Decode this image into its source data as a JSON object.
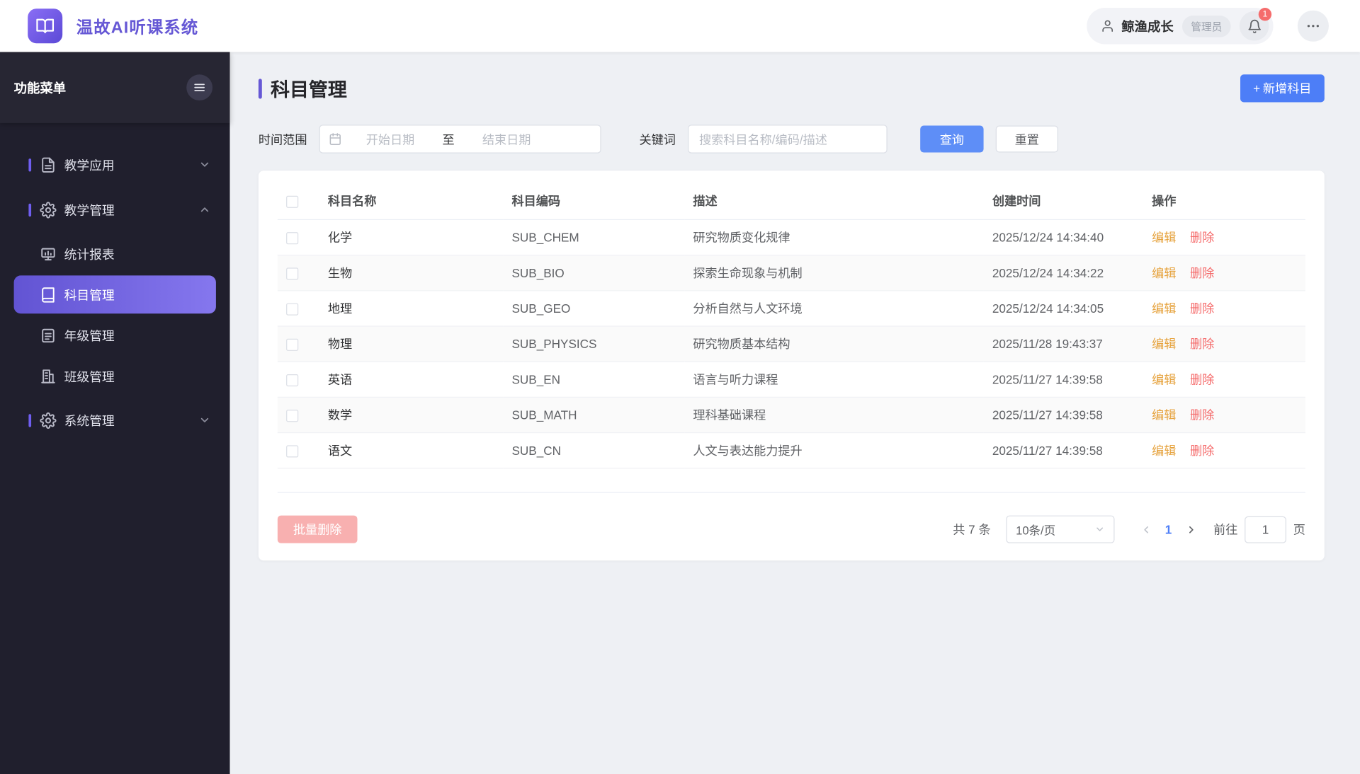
{
  "colors": {
    "brand_purple": "#6658d5",
    "primary_blue": "#4d7ef7",
    "edit_orange": "#e6a23c",
    "danger_red": "#f56c6c",
    "sidebar_bg": "#201f2d"
  },
  "header": {
    "app_title": "温故AI听课系统",
    "user_name": "鲸渔成长",
    "user_role": "管理员",
    "notification_badge": "1"
  },
  "sidebar": {
    "menu_title": "功能菜单",
    "items": {
      "teaching_app": "教学应用",
      "teaching_mgmt": "教学管理",
      "stats_report": "统计报表",
      "subject_mgmt": "科目管理",
      "grade_mgmt": "年级管理",
      "class_mgmt": "班级管理",
      "system_mgmt": "系统管理"
    }
  },
  "page": {
    "title": "科目管理",
    "add_button_icon": "+",
    "add_button": "新增科目"
  },
  "filters": {
    "date_label": "时间范围",
    "start_placeholder": "开始日期",
    "separator": "至",
    "end_placeholder": "结束日期",
    "keyword_label": "关键词",
    "keyword_placeholder": "搜索科目名称/编码/描述",
    "search_button": "查询",
    "reset_button": "重置"
  },
  "table": {
    "columns": [
      "科目名称",
      "科目编码",
      "描述",
      "创建时间",
      "操作"
    ],
    "actions": {
      "edit": "编辑",
      "delete": "删除"
    },
    "rows": [
      {
        "name": "化学",
        "code": "SUB_CHEM",
        "desc": "研究物质变化规律",
        "created": "2025/12/24 14:34:40"
      },
      {
        "name": "生物",
        "code": "SUB_BIO",
        "desc": "探索生命现象与机制",
        "created": "2025/12/24 14:34:22"
      },
      {
        "name": "地理",
        "code": "SUB_GEO",
        "desc": "分析自然与人文环境",
        "created": "2025/12/24 14:34:05"
      },
      {
        "name": "物理",
        "code": "SUB_PHYSICS",
        "desc": "研究物质基本结构",
        "created": "2025/11/28 19:43:37"
      },
      {
        "name": "英语",
        "code": "SUB_EN",
        "desc": "语言与听力课程",
        "created": "2025/11/27 14:39:58"
      },
      {
        "name": "数学",
        "code": "SUB_MATH",
        "desc": "理科基础课程",
        "created": "2025/11/27 14:39:58"
      },
      {
        "name": "语文",
        "code": "SUB_CN",
        "desc": "人文与表达能力提升",
        "created": "2025/11/27 14:39:58"
      }
    ]
  },
  "pagination": {
    "batch_delete_label": "批量删除",
    "total": "共 7 条",
    "page_size": "10条/页",
    "current_page": "1",
    "goto_label": "前往",
    "goto_value": "1",
    "goto_unit": "页"
  }
}
